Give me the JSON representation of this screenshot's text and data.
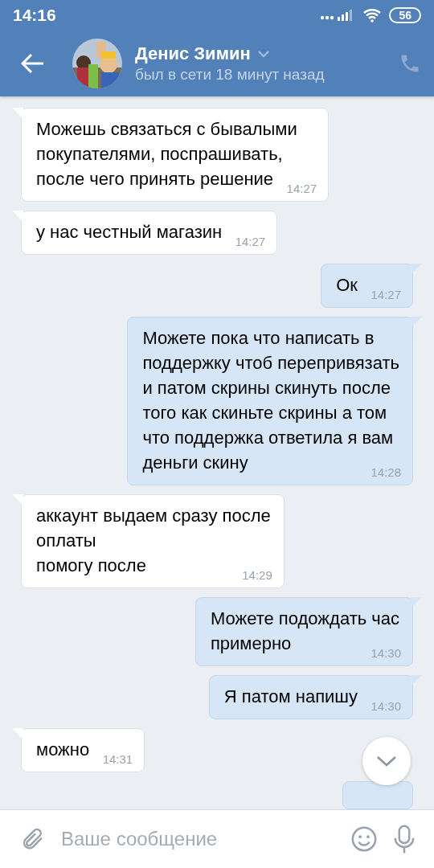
{
  "status_bar": {
    "time": "14:16",
    "battery": "56"
  },
  "header": {
    "name": "Денис Зимин",
    "status": "был в сети 18 минут назад"
  },
  "messages": [
    {
      "kind": "in",
      "text": "Можешь связаться с бывалыми\nпокупателями, поспрашивать,\nпосле чего принять решение",
      "time": "14:27"
    },
    {
      "kind": "in",
      "text": "у нас честный магазин",
      "time": "14:27"
    },
    {
      "kind": "out",
      "text": "Ок",
      "time": "14:27"
    },
    {
      "kind": "out",
      "text": "Можете пока что написать в\nподдержку чтоб перепривязать\nи патом скрины скинуть после\nтого как скиньте скрины а том\nчто поддержка ответила я вам\nденьги скину",
      "time": "14:28"
    },
    {
      "kind": "in",
      "text": "аккаунт выдаем сразу после\nоплаты\nпомогу после",
      "time": "14:29"
    },
    {
      "kind": "out",
      "text": "Можете подождать час\nпримерно",
      "time": "14:30"
    },
    {
      "kind": "out",
      "text": "Я патом напишу",
      "time": "14:30"
    },
    {
      "kind": "in",
      "text": "можно",
      "time": "14:31"
    },
    {
      "kind": "out_cut"
    }
  ],
  "composer": {
    "placeholder": "Ваше сообщение"
  }
}
